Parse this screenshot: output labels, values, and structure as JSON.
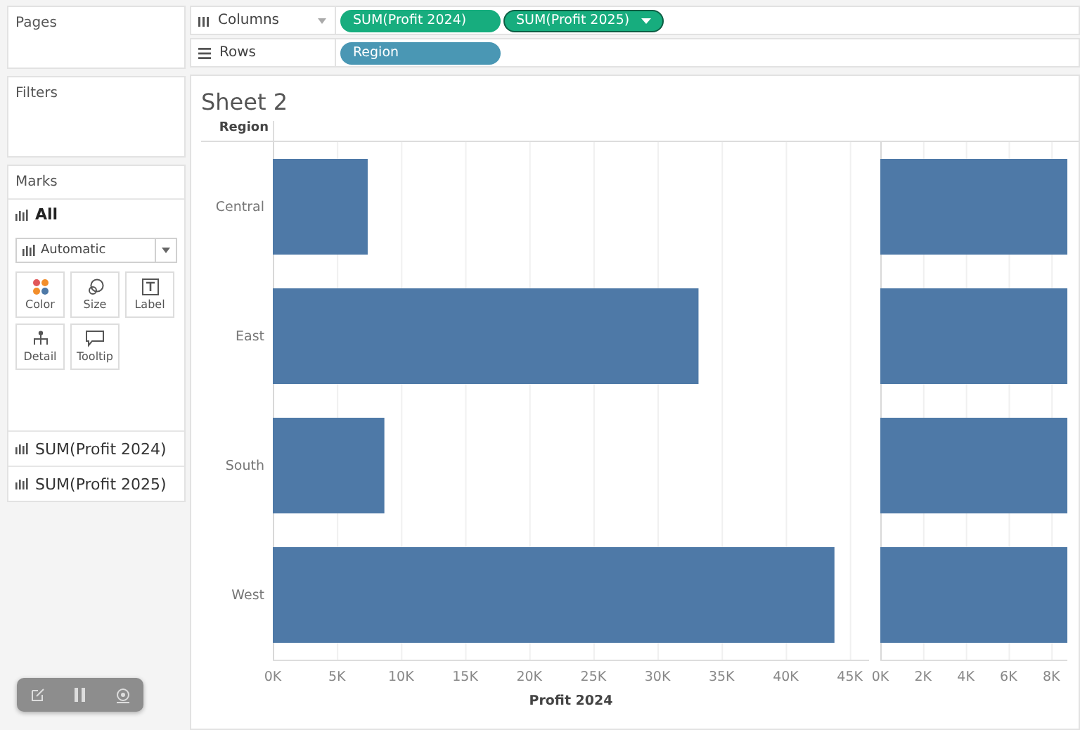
{
  "pages": {
    "title": "Pages"
  },
  "filters": {
    "title": "Filters"
  },
  "marks": {
    "title": "Marks",
    "all_label": "All",
    "mark_type": "Automatic",
    "properties": [
      {
        "label": "Color",
        "kind": "color"
      },
      {
        "label": "Size",
        "kind": "size"
      },
      {
        "label": "Label",
        "kind": "label"
      },
      {
        "label": "Detail",
        "kind": "detail"
      },
      {
        "label": "Tooltip",
        "kind": "tooltip"
      }
    ],
    "fields": [
      "SUM(Profit 2024)",
      "SUM(Profit 2025)"
    ]
  },
  "shelves": [
    {
      "label": "Columns",
      "kind": "columns",
      "pills": [
        {
          "label": "SUM(Profit 2024)",
          "kind": "measure",
          "selected": false
        },
        {
          "label": "SUM(Profit 2025)",
          "kind": "measure",
          "selected": true
        }
      ]
    },
    {
      "label": "Rows",
      "kind": "rows",
      "pills": [
        {
          "label": "Region",
          "kind": "dimension",
          "selected": false
        }
      ]
    }
  ],
  "sheet": {
    "title": "Sheet 2",
    "row_header": "Region",
    "panes": [
      {
        "chart_data": {
          "type": "bar",
          "orientation": "horizontal",
          "xlabel": "Profit 2024",
          "categories": [
            "Central",
            "East",
            "South",
            "West"
          ],
          "xlim": [
            0,
            46.5
          ],
          "grid": true,
          "xticks": [
            {
              "value": 0,
              "label": "0K"
            },
            {
              "value": 5,
              "label": "5K"
            },
            {
              "value": 10,
              "label": "10K"
            },
            {
              "value": 15,
              "label": "15K"
            },
            {
              "value": 20,
              "label": "20K"
            },
            {
              "value": 25,
              "label": "25K"
            },
            {
              "value": 30,
              "label": "30K"
            },
            {
              "value": 35,
              "label": "35K"
            },
            {
              "value": 40,
              "label": "40K"
            },
            {
              "value": 45,
              "label": "45K"
            }
          ],
          "series": [
            {
              "color": "#4e79a7",
              "values": [
                7.4,
                33.2,
                8.7,
                43.8
              ]
            }
          ]
        }
      },
      {
        "chart_data": {
          "type": "bar",
          "orientation": "horizontal",
          "categories": [
            null,
            null,
            null,
            null
          ],
          "xlim": [
            0,
            8.75
          ],
          "grid": true,
          "series": [
            {
              "color": "#4e79a7",
              "values": [
                8.75,
                8.75,
                8.75,
                8.75
              ]
            }
          ],
          "xticks": [
            {
              "value": 0,
              "label": "0K"
            },
            {
              "value": 2,
              "label": "2K"
            },
            {
              "value": 4,
              "label": "4K"
            },
            {
              "value": 6,
              "label": "6K"
            },
            {
              "value": 8,
              "label": "8K"
            }
          ]
        }
      }
    ]
  }
}
